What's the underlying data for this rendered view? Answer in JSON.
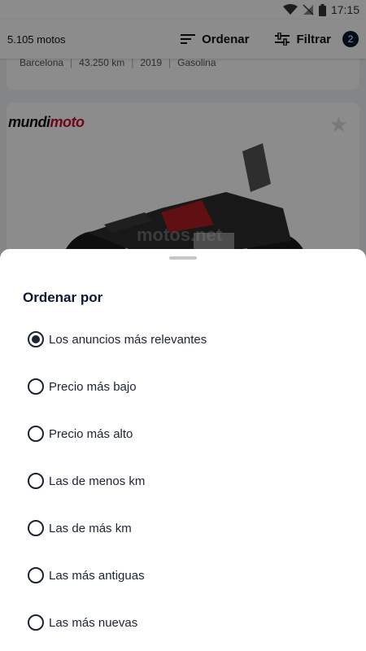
{
  "status_bar": {
    "time": "17:15"
  },
  "header": {
    "count": "5.105 motos",
    "sort_label": "Ordenar",
    "filter_label": "Filtrar",
    "filter_badge": "2"
  },
  "listing_prev": {
    "location": "Barcelona",
    "km": "43.250 km",
    "year": "2019",
    "fuel": "Gasolina"
  },
  "listing": {
    "brand_main": "mundi",
    "brand_accent": "moto",
    "watermark": "motos.net"
  },
  "sheet": {
    "title": "Ordenar por",
    "options": [
      {
        "label": "Los anuncios más relevantes",
        "selected": true
      },
      {
        "label": "Precio más bajo",
        "selected": false
      },
      {
        "label": "Precio más alto",
        "selected": false
      },
      {
        "label": "Las de menos km",
        "selected": false
      },
      {
        "label": "Las de más km",
        "selected": false
      },
      {
        "label": "Las más antiguas",
        "selected": false
      },
      {
        "label": "Las más nuevas",
        "selected": false
      }
    ]
  },
  "colors": {
    "primary": "#0b1730",
    "brand_red": "#c8102e"
  }
}
